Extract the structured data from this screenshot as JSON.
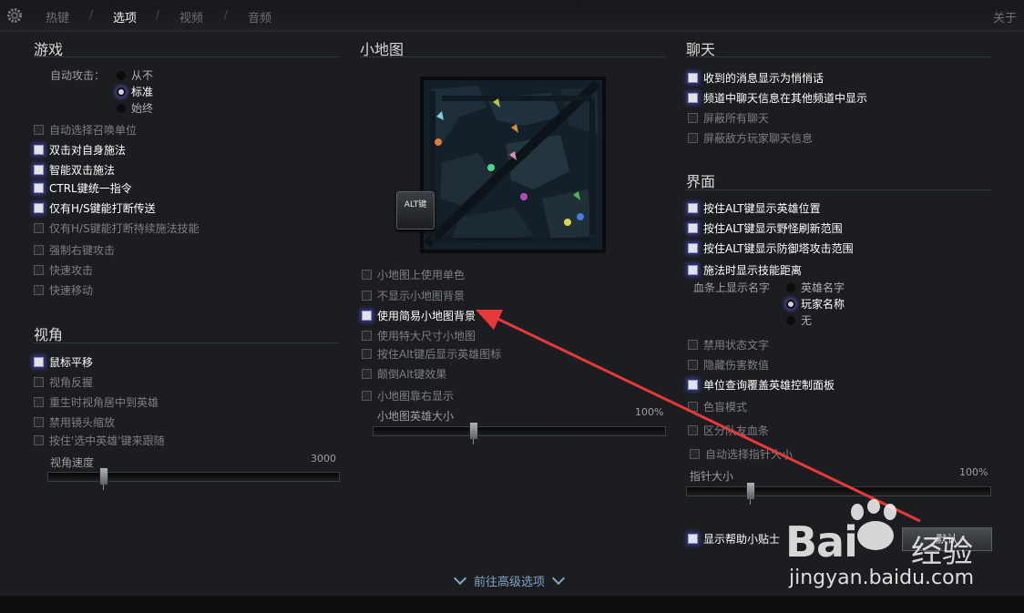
{
  "topbar": {
    "tabs": [
      "热键",
      "选项",
      "视频",
      "音频"
    ],
    "separator": "/",
    "about": "关于"
  },
  "game": {
    "title": "游戏",
    "auto_attack_label": "自动攻击：",
    "auto_attack_options": [
      "从不",
      "标准",
      "始终"
    ],
    "options": [
      {
        "label": "自动选择召唤单位",
        "checked": false
      },
      {
        "label": "双击对自身施法",
        "checked": true
      },
      {
        "label": "智能双击施法",
        "checked": true
      },
      {
        "label": "CTRL键统一指令",
        "checked": true
      },
      {
        "label": "仅有H/S键能打断传送",
        "checked": true
      },
      {
        "label": "仅有H/S键能打断持续施法技能",
        "checked": false
      },
      {
        "label": "强制右键攻击",
        "checked": false
      },
      {
        "label": "快速攻击",
        "checked": false
      },
      {
        "label": "快速移动",
        "checked": false
      }
    ]
  },
  "camera": {
    "title": "视角",
    "options": [
      {
        "label": "鼠标平移",
        "checked": true
      },
      {
        "label": "视角反握",
        "checked": false
      },
      {
        "label": "重生时视角居中到英雄",
        "checked": false
      },
      {
        "label": "禁用镜头缩放",
        "checked": false
      },
      {
        "label": "按住'选中英雄'键来跟随",
        "checked": false
      }
    ],
    "speed_label": "视角速度",
    "speed_value": "3000",
    "speed_level": 0.18
  },
  "minimap": {
    "title": "小地图",
    "alt_key": "ALT键",
    "options": [
      {
        "label": "小地图上使用单色",
        "checked": false
      },
      {
        "label": "不显示小地图背景",
        "checked": false
      },
      {
        "label": "使用简易小地图背景",
        "checked": true
      },
      {
        "label": "使用特大尺寸小地图",
        "checked": false
      },
      {
        "label": "按住Alt键后显示英雄图标",
        "checked": false
      },
      {
        "label": "颠倒Alt键效果",
        "checked": false
      },
      {
        "label": "小地图靠右显示",
        "checked": false
      }
    ],
    "hero_size_label": "小地图英雄大小",
    "hero_size_value": "100%",
    "hero_size_level": 0.34
  },
  "chat": {
    "title": "聊天",
    "options": [
      {
        "label": "收到的消息显示为悄悄话",
        "checked": true
      },
      {
        "label": "频道中聊天信息在其他频道中显示",
        "checked": true
      },
      {
        "label": "屏蔽所有聊天",
        "checked": false
      },
      {
        "label": "屏蔽敌方玩家聊天信息",
        "checked": false
      }
    ]
  },
  "interface": {
    "title": "界面",
    "options_top": [
      {
        "label": "按住ALT键显示英雄位置",
        "checked": true
      },
      {
        "label": "按住ALT键显示野怪刷新范围",
        "checked": true
      },
      {
        "label": "按住ALT键显示防御塔攻击范围",
        "checked": true
      },
      {
        "label": "施法时显示技能距离",
        "checked": true
      }
    ],
    "health_bar_name_label": "血条上显示名字",
    "health_bar_name_options": [
      "英雄名字",
      "玩家名称",
      "无"
    ],
    "options_bottom": [
      {
        "label": "禁用状态文字",
        "checked": false
      },
      {
        "label": "隐藏伤害数值",
        "checked": false
      },
      {
        "label": "单位查询覆盖英雄控制面板",
        "checked": true
      },
      {
        "label": "色盲模式",
        "checked": false
      },
      {
        "label": "区分队友血条",
        "checked": false
      },
      {
        "label": "自动选择指针大小",
        "checked": false
      }
    ],
    "pointer_size_label": "指针大小",
    "pointer_size_value": "100%",
    "pointer_size_level": 0.2,
    "show_tips_label": "显示帮助小贴士",
    "show_tips_checked": true,
    "reset_button": "默认"
  },
  "footer": {
    "advanced_link": "前往高级选项"
  },
  "watermark": {
    "brand": "Bai",
    "brand_cn": "经验",
    "url": "jingyan.baidu.com"
  },
  "colors": {
    "background": "#1b1d20",
    "accent_glow": "#3c3a8a",
    "link": "#7fa3c8",
    "annotation_arrow": "#e8393a"
  }
}
